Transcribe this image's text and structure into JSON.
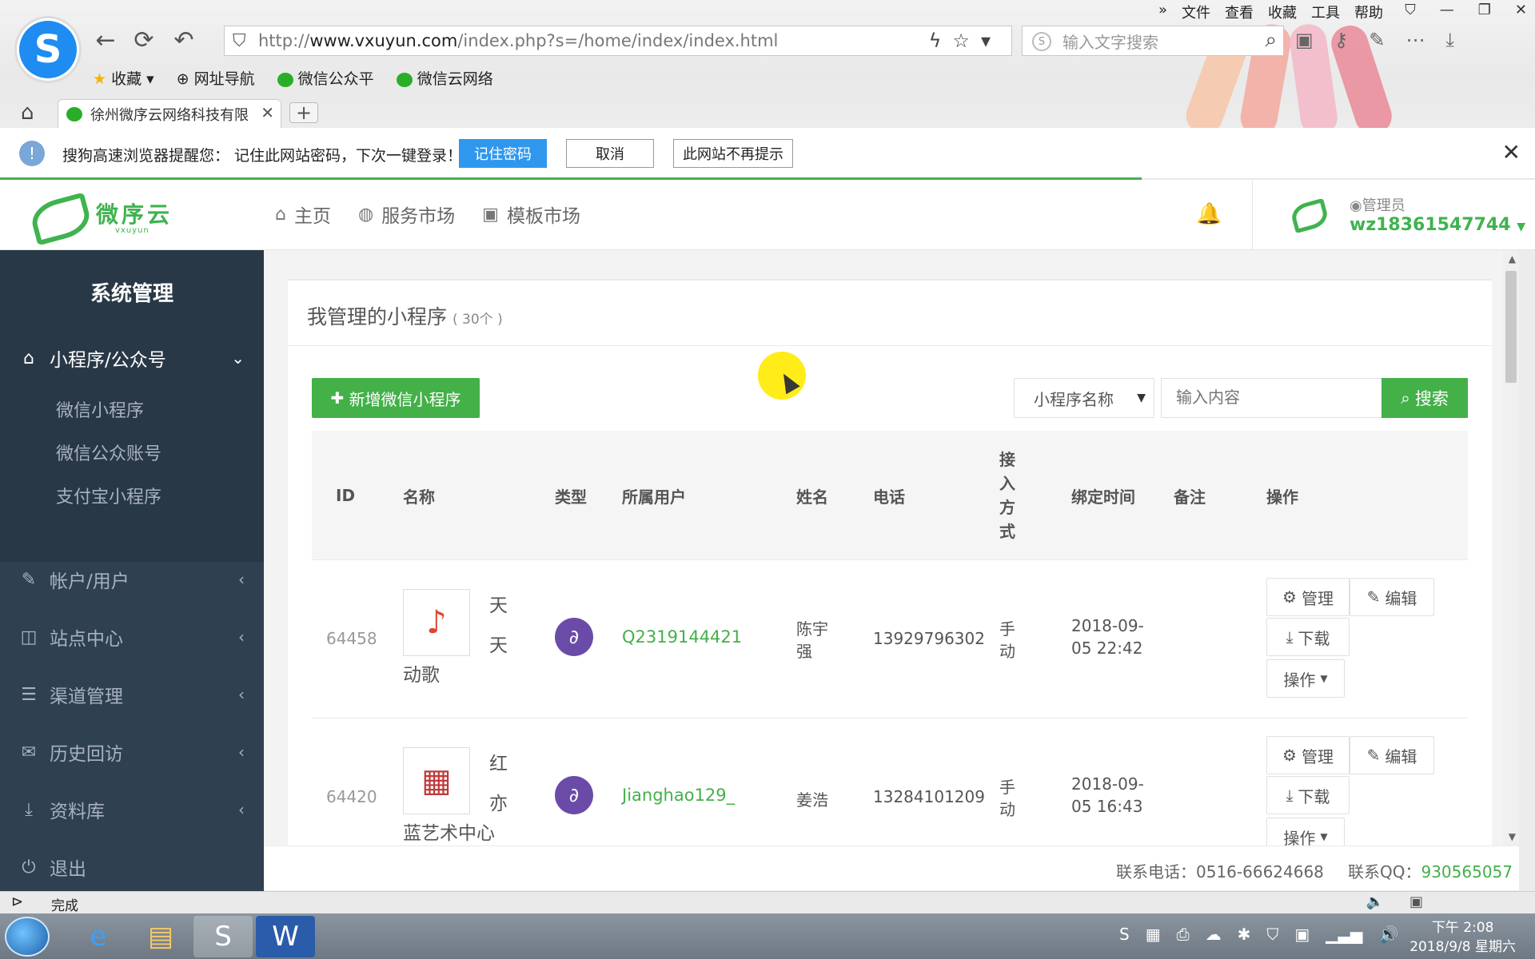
{
  "browser": {
    "menu": [
      "文件",
      "查看",
      "收藏",
      "工具",
      "帮助"
    ],
    "url_prefix": "http://",
    "url_domain": "www.vxuyun.com",
    "url_path": "/index.php?s=/home/index/index.html",
    "search_placeholder": "输入文字搜索",
    "bookmarks": [
      "收藏",
      "网址导航",
      "微信公众平",
      "微信云网络"
    ],
    "tab_title": "徐州微序云网络科技有限",
    "status_text": "完成"
  },
  "notice": {
    "message": "搜狗高速浏览器提醒您： 记住此网站密码，下次一键登录！",
    "remember_label": "记住密码",
    "cancel_label": "取消",
    "never_label": "此网站不再提示"
  },
  "header": {
    "brand_name": "微序云",
    "brand_sub": "vxuyun",
    "nav": [
      {
        "label": "主页",
        "icon": "home-icon"
      },
      {
        "label": "服务市场",
        "icon": "globe-icon"
      },
      {
        "label": "模板市场",
        "icon": "briefcase-icon"
      }
    ],
    "role": "管理员",
    "username": "wz18361547744"
  },
  "sidebar": {
    "title": "系统管理",
    "active_group": "小程序/公众号",
    "sub_items": [
      "微信小程序",
      "微信公众账号",
      "支付宝小程序"
    ],
    "groups": [
      {
        "label": "帐户/用户",
        "icon": "edit-icon"
      },
      {
        "label": "站点中心",
        "icon": "columns-icon"
      },
      {
        "label": "渠道管理",
        "icon": "sliders-icon"
      },
      {
        "label": "历史回访",
        "icon": "envelope-icon"
      },
      {
        "label": "资料库",
        "icon": "download-icon"
      },
      {
        "label": "退出",
        "icon": "power-icon"
      }
    ]
  },
  "main": {
    "title": "我管理的小程序",
    "count": "( 30个 )",
    "add_button": "新增微信小程序",
    "filter_selected": "小程序名称",
    "search_placeholder": "输入内容",
    "search_button": "搜索",
    "columns": [
      "ID",
      "名称",
      "类型",
      "所属用户",
      "姓名",
      "电话",
      "接入方式",
      "绑定时间",
      "备注",
      "操作"
    ],
    "rows": [
      {
        "id": "64458",
        "name_line1": "天",
        "name_line2": "天",
        "name_line3": "动歌",
        "owner": "Q2319144421",
        "real_name_1": "陈宇",
        "real_name_2": "强",
        "phone": "13929796302",
        "access_1": "手",
        "access_2": "动",
        "bind_date": "2018-09-",
        "bind_time": "05 22:42",
        "note": ""
      },
      {
        "id": "64420",
        "name_line1": "红",
        "name_line2": "亦",
        "name_line3": "蓝艺术中心",
        "owner": "Jianghao129_",
        "real_name_1": "姜浩",
        "real_name_2": "",
        "phone": "13284101209",
        "access_1": "手",
        "access_2": "动",
        "bind_date": "2018-09-",
        "bind_time": "05 16:43",
        "note": ""
      }
    ],
    "ops": {
      "manage": "管理",
      "edit": "编辑",
      "download": "下载",
      "more": "操作"
    }
  },
  "footer": {
    "phone_label": "联系电话：0516-66624668",
    "qq_label": "联系QQ：",
    "qq_value": "930565057"
  },
  "taskbar": {
    "time": "下午 2:08",
    "date": "2018/9/8 星期六"
  },
  "colors": {
    "accent_green": "#43b048",
    "sidebar_bg": "#2f4050",
    "notice_btn_blue": "#2f98ee"
  }
}
